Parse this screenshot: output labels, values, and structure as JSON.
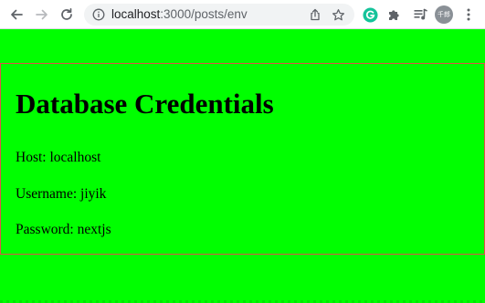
{
  "browser": {
    "url_host": "localhost",
    "url_path": ":3000/posts/env",
    "avatar_text": "千郎",
    "icons": {
      "back": "back-arrow-icon",
      "forward": "forward-arrow-icon",
      "reload": "reload-icon",
      "info": "info-icon",
      "share": "share-icon",
      "bookmark": "star-icon",
      "grammarly": "grammarly-icon",
      "extensions": "puzzle-icon",
      "media": "media-controls-icon",
      "menu": "kebab-menu-icon"
    },
    "colors": {
      "grammarly": "#15c39a",
      "avatar": "#8a9096"
    }
  },
  "page": {
    "background": "#00ff00",
    "border_color": "#e0504a",
    "title": "Database Credentials",
    "lines": {
      "host": "Host: localhost",
      "username": "Username: jiyik",
      "password": "Password: nextjs"
    }
  }
}
